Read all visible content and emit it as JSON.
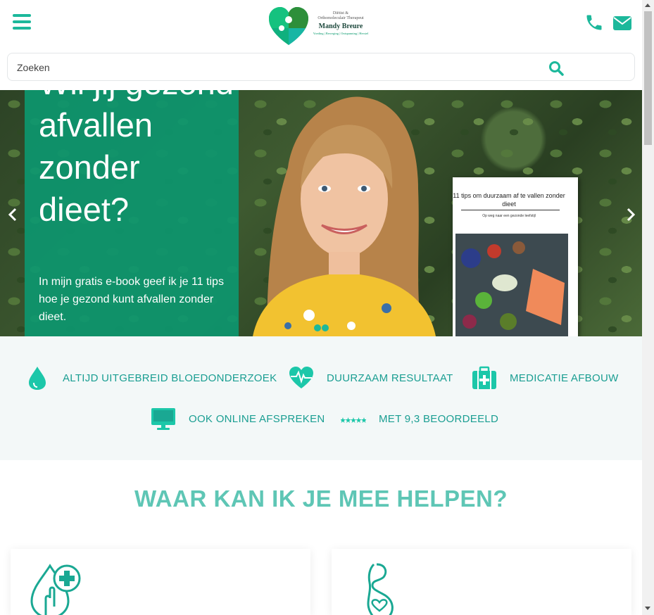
{
  "header": {
    "logo": {
      "subtitle_line1": "Diëtist &",
      "subtitle_line2": "Orthomoleculair Therapeut",
      "name": "Mandy Breure",
      "tagline": "Voeding | Beweging | Ontspanning | Herstel"
    },
    "icons": [
      "menu-icon",
      "phone-icon",
      "mail-icon"
    ],
    "accent_color": "#1cb89b"
  },
  "search": {
    "placeholder": "Zoeken",
    "value": ""
  },
  "hero": {
    "title": "Wil jij gezond afvallen zonder dieet?",
    "text": "In mijn gratis e-book geef ik je 11 tips hoe je gezond kunt afvallen zonder dieet.",
    "book": {
      "title": "11 tips om duurzaam af te vallen zonder dieet",
      "subtitle": "Op weg naar een gezonde leefstijl"
    },
    "slide_count": 2,
    "active_slide": 1
  },
  "features": [
    {
      "label": "ALTIJD UITGEBREID BLOEDONDERZOEK",
      "icon": "blood-drop-icon"
    },
    {
      "label": "DUURZAAM RESULTAAT",
      "icon": "heart-pulse-icon"
    },
    {
      "label": "MEDICATIE AFBOUW",
      "icon": "medical-kit-icon"
    },
    {
      "label": "OOK ONLINE AFSPREKEN",
      "icon": "monitor-icon"
    },
    {
      "label": "MET 9,3 BEOORDEELD",
      "icon": "stars-icon"
    }
  ],
  "section": {
    "title": "WAAR KAN IK JE MEE HELPEN?",
    "cards": [
      {
        "icon": "diabetes-drop-plus-icon"
      },
      {
        "icon": "pregnancy-icon"
      }
    ]
  }
}
